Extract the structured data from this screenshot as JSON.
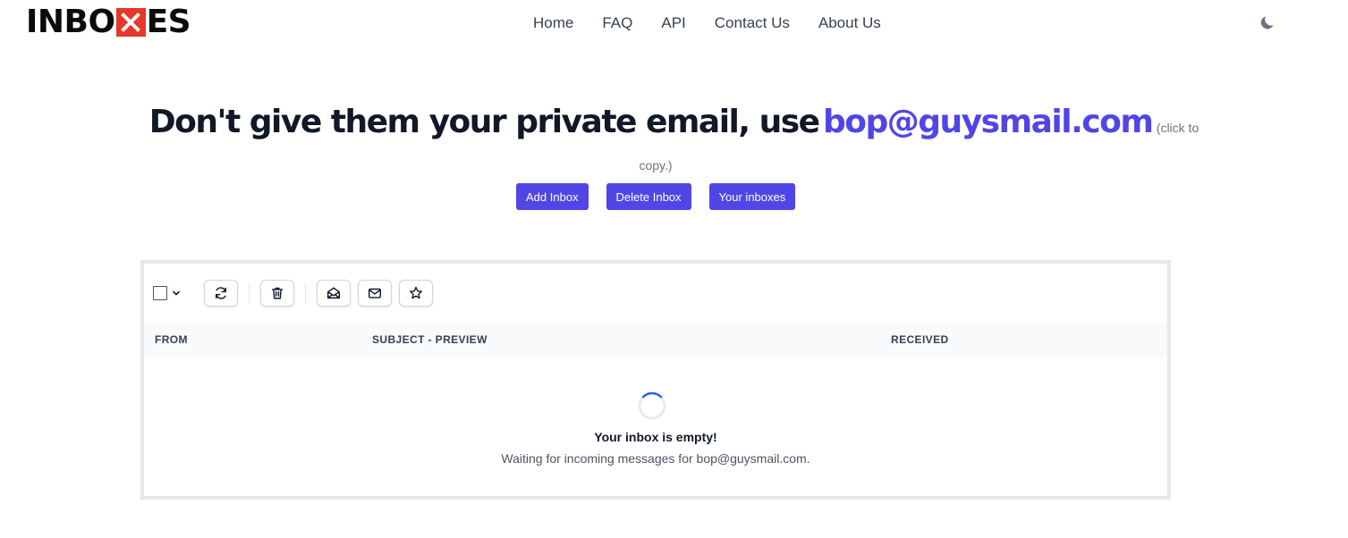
{
  "brand": {
    "logo_left": "INBO",
    "logo_right": "ES",
    "logo_accent": "#e5382a"
  },
  "nav": {
    "items": [
      "Home",
      "FAQ",
      "API",
      "Contact Us",
      "About Us"
    ]
  },
  "theme_toggle_icon": "moon-icon",
  "hero": {
    "headline": "Don't give them your private email, use",
    "email": "bop@guysmail.com",
    "hint_part1": "(click to",
    "hint_part2": "copy.)"
  },
  "actions": {
    "add": "Add Inbox",
    "delete": "Delete Inbox",
    "list": "Your inboxes"
  },
  "toolbar_icons": [
    "refresh-icon",
    "trash-icon",
    "envelope-open-icon",
    "envelope-icon",
    "star-icon"
  ],
  "table": {
    "col_from": "FROM",
    "col_subject": "SUBJECT - PREVIEW",
    "col_received": "RECEIVED"
  },
  "empty_state": {
    "title": "Your inbox is empty!",
    "message": "Waiting for incoming messages for bop@guysmail.com."
  },
  "colors": {
    "accent": "#5046e5",
    "text": "#111827",
    "muted": "#6b7280"
  }
}
